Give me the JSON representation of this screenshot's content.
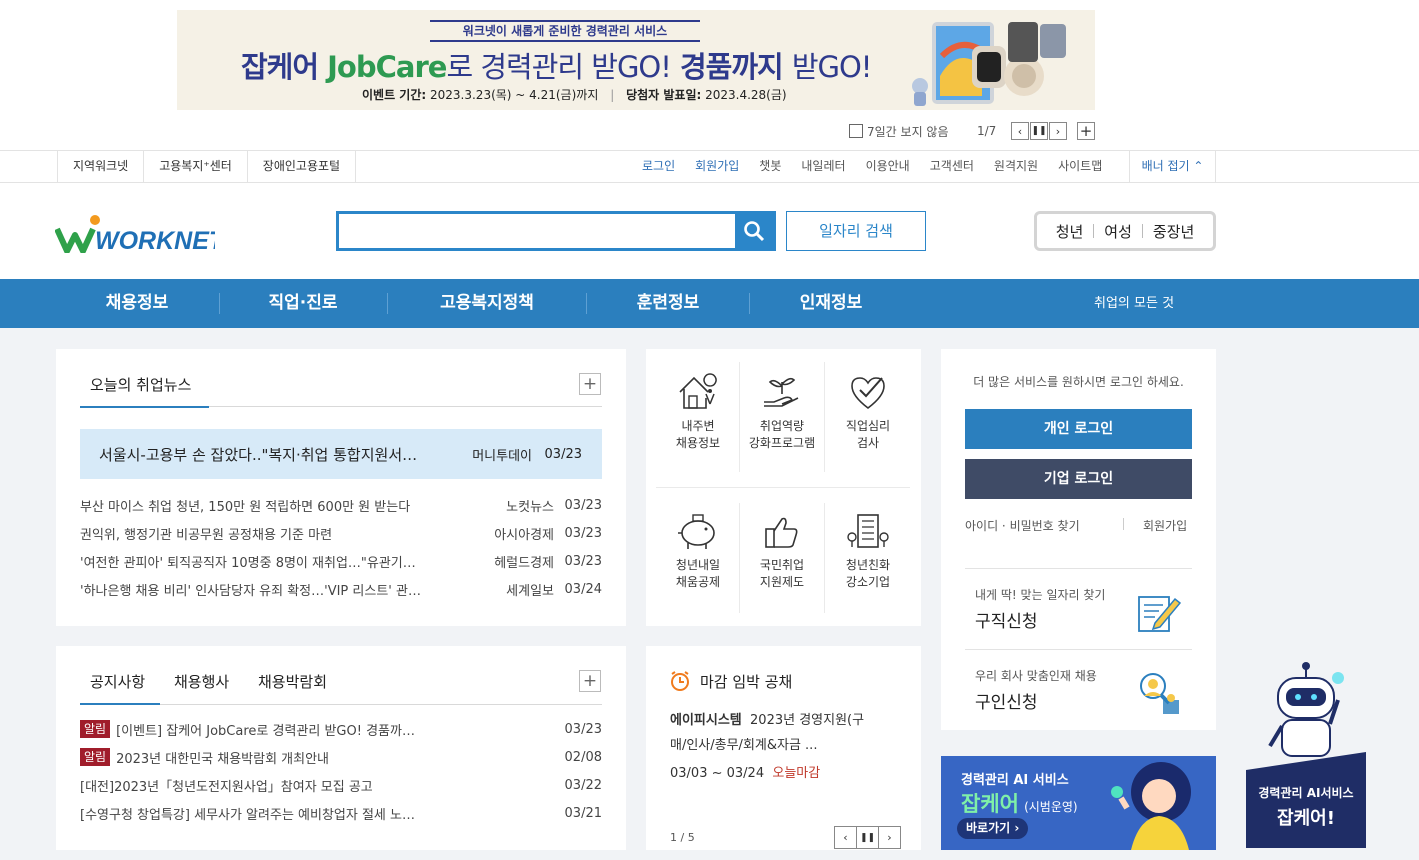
{
  "banner": {
    "subtitle": "워크넷이 새롭게 준비한 경력관리 서비스",
    "headline_part1": "잡케어 ",
    "headline_jobcare": "JobCare",
    "headline_part2": "로 경력관리 ",
    "headline_go1": "받GO!",
    "headline_part3": " 경품까지 ",
    "headline_go2": "받GO!",
    "period_label": "이벤트 기간:",
    "period_value": " 2023.3.23(목) ~ 4.21(금)까지",
    "winner_label": "당첨자 발표일:",
    "winner_value": " 2023.4.28(금)",
    "hide_week": "7일간 보지 않음",
    "page": "1/7"
  },
  "util": {
    "left": [
      "지역워크넷",
      "고용복지⁺센터",
      "장애인고용포털"
    ],
    "right": [
      "로그인",
      "회원가입",
      "챗봇",
      "내일레터",
      "이용안내",
      "고객센터",
      "원격지원",
      "사이트맵"
    ],
    "fold": "배너 접기"
  },
  "header": {
    "logo": "WORKNET",
    "search_placeholder": "",
    "job_search": "일자리 검색",
    "ages": [
      "청년",
      "여성",
      "중장년"
    ]
  },
  "gnb": {
    "items": [
      "채용정보",
      "직업·진로",
      "고용복지정책",
      "훈련정보",
      "인재정보"
    ],
    "all": "취업의 모든 것"
  },
  "news": {
    "title": "오늘의 취업뉴스",
    "headline": {
      "title": "서울시-고용부 손 잡았다..\"복지·취업 통합지원서…",
      "source": "머니투데이",
      "date": "03/23"
    },
    "items": [
      {
        "title": "부산 마이스 취업 청년, 150만 원 적립하면 600만 원 받는다",
        "source": "노컷뉴스",
        "date": "03/23"
      },
      {
        "title": "권익위, 행정기관 비공무원 공정채용 기준 마련",
        "source": "아시아경제",
        "date": "03/23"
      },
      {
        "title": "'여전한 관피아' 퇴직공직자 10명중 8명이 재취업…\"유관기…",
        "source": "헤럴드경제",
        "date": "03/23"
      },
      {
        "title": "'하나은행 채용 비리' 인사담당자 유죄 확정…'VIP 리스트' 관…",
        "source": "세계일보",
        "date": "03/24"
      }
    ]
  },
  "services": [
    {
      "line1": "내주변",
      "line2": "채용정보",
      "icon": "house-location-icon"
    },
    {
      "line1": "취업역량",
      "line2": "강화프로그램",
      "icon": "hand-sprout-icon"
    },
    {
      "line1": "직업심리",
      "line2": "검사",
      "icon": "heart-check-icon"
    },
    {
      "line1": "청년내일",
      "line2": "채움공제",
      "icon": "piggy-bank-icon"
    },
    {
      "line1": "국민취업",
      "line2": "지원제도",
      "icon": "thumbs-up-icon"
    },
    {
      "line1": "청년친화",
      "line2": "강소기업",
      "icon": "building-icon"
    }
  ],
  "login": {
    "notice": "더 많은 서비스를 원하시면 로그인 하세요.",
    "personal": "개인 로그인",
    "company": "기업 로그인",
    "find": "아이디 · 비밀번호 찾기",
    "join": "회원가입",
    "job_apply_desc": "내게 딱! 맞는 일자리 찾기",
    "job_apply": "구직신청",
    "hire_desc": "우리 회사 맞춤인재 채용",
    "hire": "구인신청"
  },
  "notice": {
    "tabs": [
      "공지사항",
      "채용행사",
      "채용박람회"
    ],
    "badge": "알림",
    "items": [
      {
        "badge": true,
        "title": "[이벤트] 잡케어 JobCare로 경력관리 받GO! 경품까…",
        "date": "03/23"
      },
      {
        "badge": true,
        "title": "2023년 대한민국 채용박람회 개최안내",
        "date": "02/08"
      },
      {
        "badge": false,
        "title": "[대전]2023년「청년도전지원사업」참여자 모집 공고",
        "date": "03/22"
      },
      {
        "badge": false,
        "title": "[수영구청 창업특강] 세무사가 알려주는 예비창업자 절세 노…",
        "date": "03/21"
      }
    ]
  },
  "deadline": {
    "title": "마감 임박 공채",
    "company": "에이피시스템",
    "desc1": "2023년 경영지원(구",
    "desc2": "매/인사/총무/회계&자금 ...",
    "range": "03/03 ~ 03/24",
    "status": "오늘마감",
    "page": "1 / 5"
  },
  "ai_banner": {
    "line1": "경력관리 AI 서비스",
    "brand": "잡케어",
    "pilot": "(시범운영)",
    "go": "바로가기"
  },
  "robot": {
    "line1": "경력관리 AI서비스",
    "line2": "잡케어!"
  },
  "colors": {
    "primary": "#2b7fbe",
    "dark_btn": "#3f4b66",
    "badge": "#a01d2b",
    "deadline_red": "#c0392b"
  }
}
